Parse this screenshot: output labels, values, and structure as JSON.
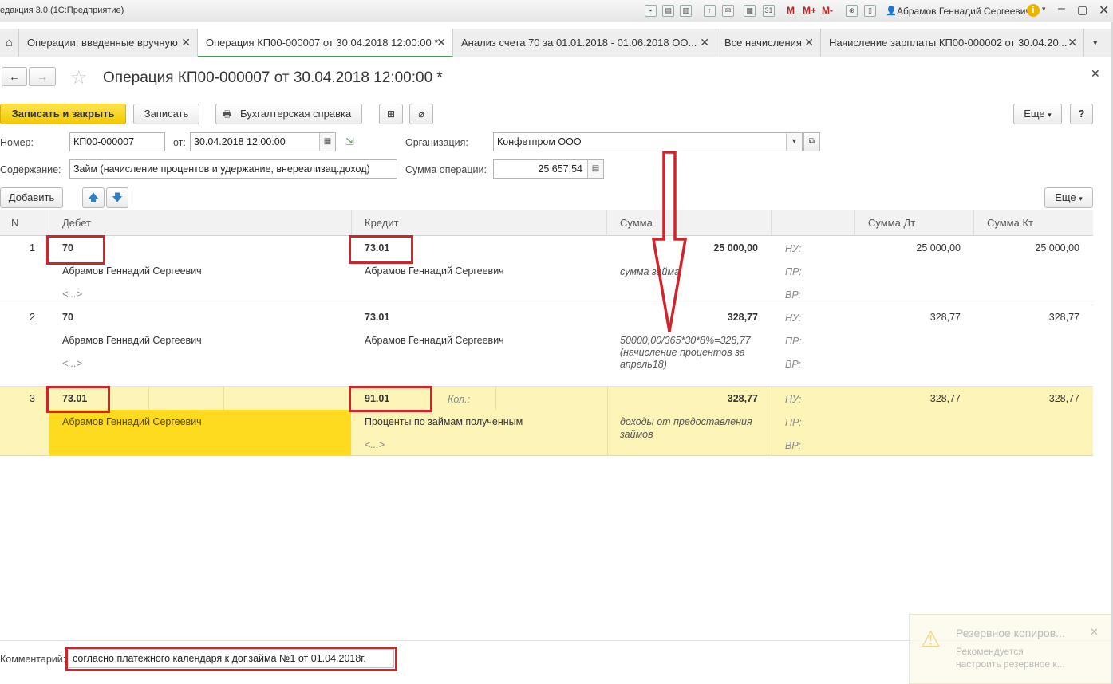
{
  "window": {
    "app_title": "едакция 3.0  (1С:Предприятие)",
    "user_name": "Абрамов Геннадий Сергеевич",
    "toolbar_m": "M",
    "toolbar_mplus": "M+",
    "toolbar_mminus": "M-"
  },
  "tabs": [
    {
      "label": "Операции, введенные вручную"
    },
    {
      "label": "Операция КП00-000007 от 30.04.2018 12:00:00 *"
    },
    {
      "label": "Анализ счета 70 за 01.01.2018 - 01.06.2018 ОО..."
    },
    {
      "label": "Все начисления"
    },
    {
      "label": "Начисление зарплаты КП00-000002 от 30.04.20..."
    }
  ],
  "form": {
    "title": "Операция КП00-000007 от 30.04.2018 12:00:00 *",
    "buttons": {
      "save_close": "Записать и закрыть",
      "save": "Записать",
      "accounting_note": "Бухгалтерская справка",
      "more": "Еще",
      "help": "?",
      "add": "Добавить",
      "more2": "Еще"
    },
    "number_label": "Номер:",
    "number_value": "КП00-000007",
    "date_label": "от:",
    "date_value": "30.04.2018 12:00:00",
    "org_label": "Организация:",
    "org_value": "Конфетпром ООО",
    "content_label": "Содержание:",
    "content_value": "Займ (начисление процентов и удержание, внереализац.доход)",
    "sum_label": "Сумма операции:",
    "sum_value": "25 657,54",
    "comment_label": "Комментарий:",
    "comment_value": "согласно платежного календаря к дог.займа №1 от 01.04.2018г."
  },
  "table": {
    "headers": {
      "n": "N",
      "debit": "Дебет",
      "credit": "Кредит",
      "sum": "Сумма",
      "sum_dt": "Сумма Дт",
      "sum_kt": "Сумма Кт"
    },
    "rows": [
      {
        "n": "1",
        "debit": "70",
        "debit_sub1": "Абрамов Геннадий Сергеевич",
        "debit_sub2": "<...>",
        "credit": "73.01",
        "credit_sub1": "Абрамов Геннадий Сергеевич",
        "credit_sub2": "",
        "qty": "",
        "sum": "25 000,00",
        "note": "сумма займа",
        "nu": "НУ:",
        "pr": "ПР:",
        "vr": "ВР:",
        "sum_dt": "25 000,00",
        "sum_kt": "25 000,00"
      },
      {
        "n": "2",
        "debit": "70",
        "debit_sub1": "Абрамов Геннадий Сергеевич",
        "debit_sub2": "<...>",
        "credit": "73.01",
        "credit_sub1": "Абрамов Геннадий Сергеевич",
        "credit_sub2": "",
        "qty": "",
        "sum": "328,77",
        "note": "50000,00/365*30*8%=328,77",
        "note2": "(начисление процентов за",
        "note3": "апрель18)",
        "nu": "НУ:",
        "pr": "ПР:",
        "vr": "ВР:",
        "sum_dt": "328,77",
        "sum_kt": "328,77"
      },
      {
        "n": "3",
        "debit": "73.01",
        "debit_sub1": "Абрамов Геннадий Сергеевич",
        "debit_sub2": "",
        "credit": "91.01",
        "credit_sub1": "Проценты по займам полученным",
        "credit_sub2": "<...>",
        "qty": "Кол.:",
        "sum": "328,77",
        "note": "доходы от предоставления",
        "note2": "займов",
        "nu": "НУ:",
        "pr": "ПР:",
        "vr": "ВР:",
        "sum_dt": "328,77",
        "sum_kt": "328,77"
      }
    ]
  },
  "notification": {
    "title": "Резервное копиров...",
    "line1": "Рекомендуется",
    "line2": "настроить резервное к..."
  },
  "colors": {
    "accent_yellow": "#f3c800",
    "row_selected": "#fdf5b8",
    "cell_focus": "#ffdb1f",
    "annotation_red": "#d2232a",
    "active_tab_underline": "#4a9b5f"
  }
}
